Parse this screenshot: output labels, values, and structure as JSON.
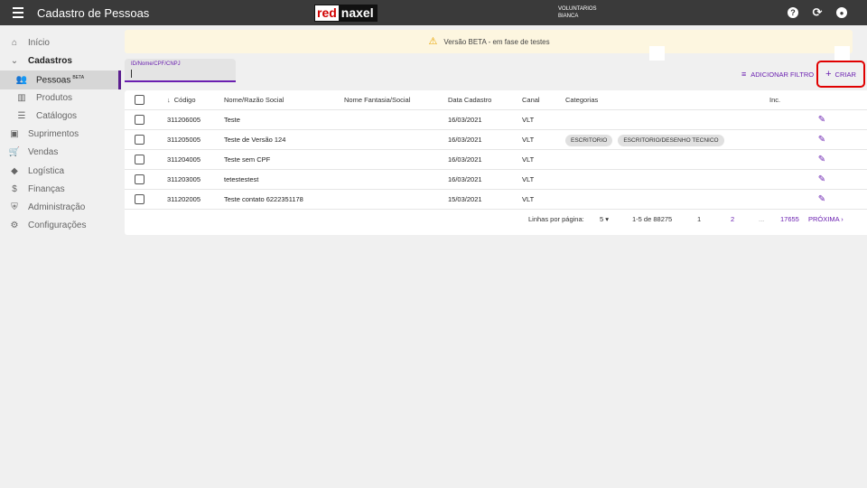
{
  "topbar": {
    "title": "Cadastro de Pessoas",
    "logo_left": "red",
    "logo_right": "naxel",
    "user_line1": "VOLUNTARIOS",
    "user_line2": "BIANCA",
    "help_glyph": "?",
    "refresh_glyph": "⟳",
    "account_glyph": "●"
  },
  "sidebar": {
    "items": [
      {
        "label": "Início",
        "icon": "home-icon"
      },
      {
        "label": "Cadastros",
        "icon": "chevron-down-icon"
      },
      {
        "label": "Pessoas",
        "badge": "BETA",
        "icon": "people-icon"
      },
      {
        "label": "Produtos",
        "icon": "book-icon"
      },
      {
        "label": "Catálogos",
        "icon": "list-icon"
      },
      {
        "label": "Suprimentos",
        "icon": "box-icon"
      },
      {
        "label": "Vendas",
        "icon": "cart-icon"
      },
      {
        "label": "Logística",
        "icon": "route-icon"
      },
      {
        "label": "Finanças",
        "icon": "dollar-icon"
      },
      {
        "label": "Administração",
        "icon": "shield-icon"
      },
      {
        "label": "Configurações",
        "icon": "gear-icon"
      }
    ]
  },
  "banner": {
    "text": "Versão BETA - em fase de testes",
    "icon": "warning-icon",
    "accent": "#e8a400"
  },
  "search": {
    "label": "ID/Nome/CPF/CNPJ",
    "value": ""
  },
  "toolbar": {
    "filter_label": "ADICIONAR FILTRO",
    "create_label": "CRIAR",
    "accent": "#6a1fb0",
    "highlight": "#e00000"
  },
  "table": {
    "headers": {
      "code": "Código",
      "name": "Nome/Razão Social",
      "fantasy": "Nome Fantasia/Social",
      "date": "Data Cadastro",
      "canal": "Canal",
      "categories": "Categorias",
      "inc": "Inc."
    },
    "rows": [
      {
        "code": "311206005",
        "name": "Teste",
        "fantasy": "",
        "date": "16/03/2021",
        "canal": "VLT",
        "categories": []
      },
      {
        "code": "311205005",
        "name": "Teste de Versão 124",
        "fantasy": "",
        "date": "16/03/2021",
        "canal": "VLT",
        "categories": [
          "ESCRITORIO",
          "ESCRITORIO/DESENHO TECNICO"
        ]
      },
      {
        "code": "311204005",
        "name": "Teste sem CPF",
        "fantasy": "",
        "date": "16/03/2021",
        "canal": "VLT",
        "categories": []
      },
      {
        "code": "311203005",
        "name": "tetestestest",
        "fantasy": "",
        "date": "16/03/2021",
        "canal": "VLT",
        "categories": []
      },
      {
        "code": "311202005",
        "name": "Teste contato 6222351178",
        "fantasy": "",
        "date": "15/03/2021",
        "canal": "VLT",
        "categories": []
      }
    ]
  },
  "pagination": {
    "rows_per_page_label": "Linhas por página:",
    "rows_per_page": "5",
    "range": "1-5 de 88275",
    "page_1": "1",
    "page_2": "2",
    "ellipsis": "...",
    "last_page": "17655",
    "next_label": "PRÓXIMA"
  }
}
